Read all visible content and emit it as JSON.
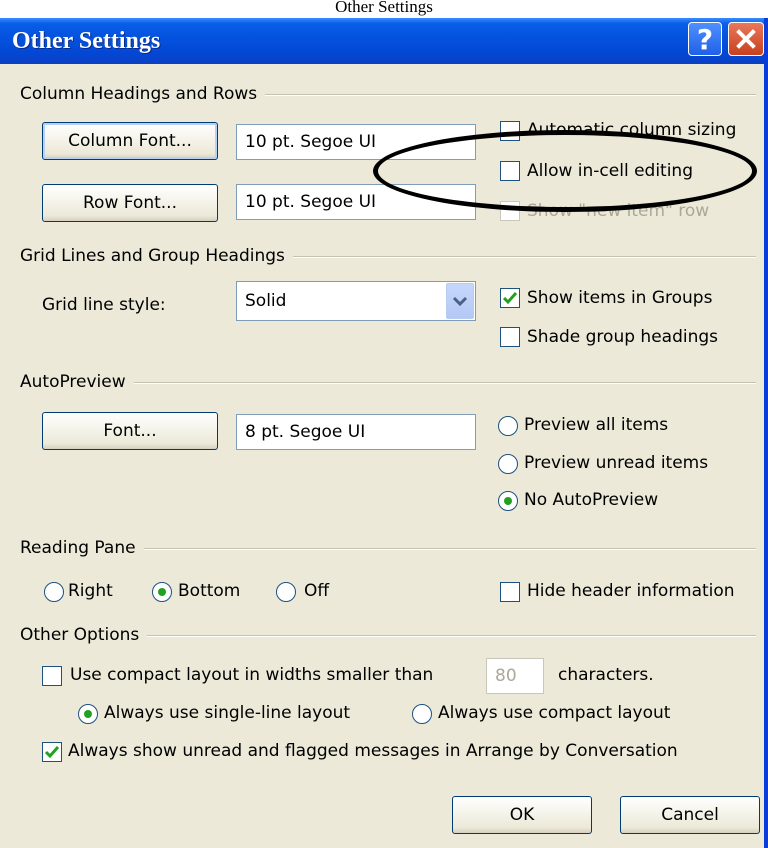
{
  "caption": "Other Settings",
  "window": {
    "title": "Other Settings",
    "help_glyph": "?"
  },
  "groups": {
    "column_headings": "Column Headings and Rows",
    "grid_lines": "Grid Lines and Group Headings",
    "autopreview": "AutoPreview",
    "reading_pane": "Reading Pane",
    "other_options": "Other Options"
  },
  "column_headings": {
    "column_font_button": "Column Font...",
    "column_font_value": "10 pt. Segoe UI",
    "row_font_button": "Row Font...",
    "row_font_value": "10 pt. Segoe UI",
    "auto_sizing": "Automatic column sizing",
    "allow_in_cell": "Allow in-cell editing",
    "show_new_item": "Show \"new item\" row"
  },
  "grid_lines": {
    "style_label": "Grid line style:",
    "style_value": "Solid",
    "show_in_groups": "Show items in Groups",
    "shade_headings": "Shade group headings"
  },
  "autopreview": {
    "font_button": "Font...",
    "font_value": "8 pt. Segoe UI",
    "preview_all": "Preview all items",
    "preview_unread": "Preview unread items",
    "no_autopreview": "No AutoPreview"
  },
  "reading_pane": {
    "right": "Right",
    "bottom": "Bottom",
    "off": "Off",
    "hide_header": "Hide header information"
  },
  "other_options": {
    "compact_prefix": "Use compact layout in widths smaller than",
    "compact_width": "80",
    "compact_suffix": "characters.",
    "single_line": "Always use single-line layout",
    "compact_always": "Always use compact layout",
    "show_unread_flagged": "Always show unread and flagged messages in Arrange by Conversation"
  },
  "buttons": {
    "ok": "OK",
    "cancel": "Cancel"
  },
  "state": {
    "auto_sizing": false,
    "allow_in_cell": false,
    "show_new_item": false,
    "show_in_groups": true,
    "shade_headings": false,
    "hide_header": false,
    "use_compact": false,
    "show_unread_flagged": true,
    "autopreview_selected": "No AutoPreview",
    "reading_pane_selected": "Bottom",
    "layout_selected": "Always use single-line layout"
  },
  "colors": {
    "titlebar": "#0453df",
    "dialog_bg": "#ece9d8",
    "check_green": "#21a121",
    "close_red": "#c8401f"
  }
}
